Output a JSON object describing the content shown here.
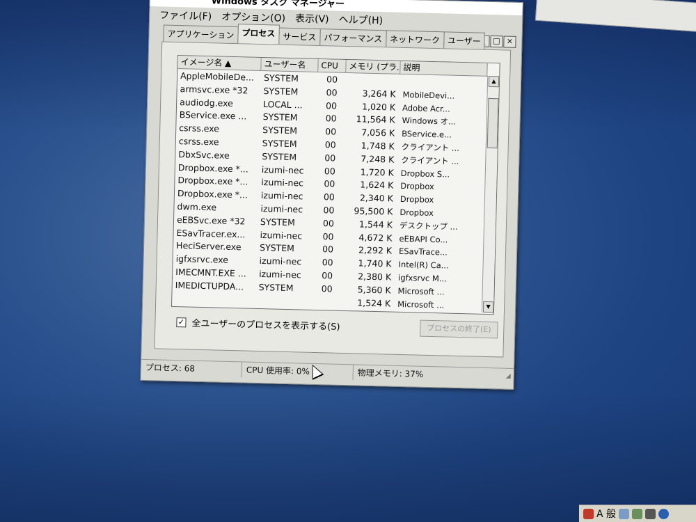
{
  "window": {
    "title": "Windows タスク マネージャー"
  },
  "menu": [
    "ファイル(F)",
    "オプション(O)",
    "表示(V)",
    "ヘルプ(H)"
  ],
  "window_buttons": {
    "minimize": "_",
    "maximize": "□",
    "close": "×"
  },
  "tabs": [
    {
      "label": "アプリケーション",
      "active": false
    },
    {
      "label": "プロセス",
      "active": true
    },
    {
      "label": "サービス",
      "active": false
    },
    {
      "label": "パフォーマンス",
      "active": false
    },
    {
      "label": "ネットワーク",
      "active": false
    },
    {
      "label": "ユーザー",
      "active": false
    }
  ],
  "columns": [
    "イメージ名 ▲",
    "ユーザー名",
    "CPU",
    "メモリ (プラ...",
    "説明"
  ],
  "rows": [
    [
      "AppleMobileDe...",
      "SYSTEM",
      "00",
      "",
      ""
    ],
    [
      "armsvc.exe *32",
      "SYSTEM",
      "00",
      "3,264 K",
      "MobileDevi..."
    ],
    [
      "audiodg.exe",
      "LOCAL ...",
      "00",
      "1,020 K",
      "Adobe Acr..."
    ],
    [
      "BService.exe ...",
      "SYSTEM",
      "00",
      "11,564 K",
      "Windows オ..."
    ],
    [
      "csrss.exe",
      "SYSTEM",
      "00",
      "7,056 K",
      "BService.e..."
    ],
    [
      "csrss.exe",
      "SYSTEM",
      "00",
      "1,748 K",
      "クライアント ..."
    ],
    [
      "DbxSvc.exe",
      "SYSTEM",
      "00",
      "7,248 K",
      "クライアント ..."
    ],
    [
      "Dropbox.exe *...",
      "izumi-nec",
      "00",
      "1,720 K",
      "Dropbox S..."
    ],
    [
      "Dropbox.exe *...",
      "izumi-nec",
      "00",
      "1,624 K",
      "Dropbox"
    ],
    [
      "Dropbox.exe *...",
      "izumi-nec",
      "00",
      "2,340 K",
      "Dropbox"
    ],
    [
      "dwm.exe",
      "izumi-nec",
      "00",
      "95,500 K",
      "Dropbox"
    ],
    [
      "eEBSvc.exe *32",
      "SYSTEM",
      "00",
      "1,544 K",
      "デスクトップ ..."
    ],
    [
      "ESavTracer.ex...",
      "izumi-nec",
      "00",
      "4,672 K",
      "eEBAPI Co..."
    ],
    [
      "HeciServer.exe",
      "SYSTEM",
      "00",
      "2,292 K",
      "ESavTrace..."
    ],
    [
      "igfxsrvc.exe",
      "izumi-nec",
      "00",
      "1,740 K",
      "Intel(R) Ca..."
    ],
    [
      "IMECMNT.EXE ...",
      "izumi-nec",
      "00",
      "2,380 K",
      "igfxsrvc M..."
    ],
    [
      "IMEDICTUPDA...",
      "SYSTEM",
      "00",
      "5,360 K",
      "Microsoft ..."
    ],
    [
      "",
      "",
      "",
      "1,524 K",
      "Microsoft ..."
    ]
  ],
  "show_all_users": {
    "label": "全ユーザーのプロセスを表示する(S)",
    "checked": true
  },
  "end_process_button": "プロセスの終了(E)",
  "status": {
    "processes": "プロセス: 68",
    "cpu_usage": "CPU 使用率: 0%",
    "physical_memory": "物理メモリ: 37%"
  },
  "tray": {
    "ime_label": "A 般"
  },
  "colors": {
    "desktop": "#2e5590",
    "window_face": "#d9d9d3",
    "list_bg": "#f4f4f1"
  }
}
